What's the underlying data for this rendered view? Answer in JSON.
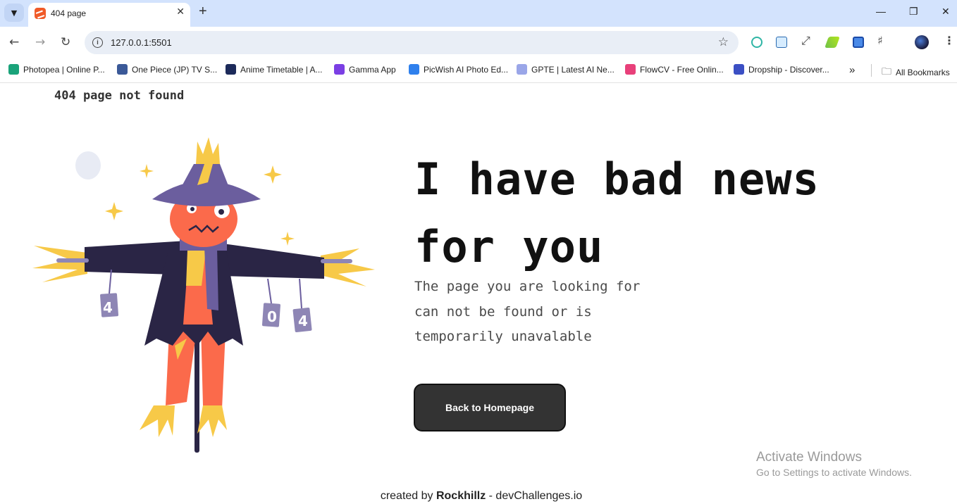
{
  "browser": {
    "tab_title": "404 page",
    "url": "127.0.0.1:5501",
    "bookmarks": [
      {
        "label": "Photopea | Online P...",
        "color": "#1aa37a"
      },
      {
        "label": "One Piece (JP) TV S...",
        "color": "#3b5998"
      },
      {
        "label": "Anime Timetable | A...",
        "color": "#1c2a5a"
      },
      {
        "label": "Gamma App",
        "color": "#7b3fe4"
      },
      {
        "label": "PicWish AI Photo Ed...",
        "color": "#2f80ed"
      },
      {
        "label": "GPTE | Latest AI Ne...",
        "color": "#9aa6e8"
      },
      {
        "label": "FlowCV - Free Onlin...",
        "color": "#e8407a"
      },
      {
        "label": "Dropship - Discover...",
        "color": "#3b4fc4"
      }
    ],
    "more_bookmarks": "»",
    "all_bookmarks": "All Bookmarks"
  },
  "page": {
    "logo": "404 page not found",
    "headline_line1": "I have bad news",
    "headline_line2": "for you",
    "sub_line1": "The page you are looking for",
    "sub_line2": "can not be found or is",
    "sub_line3": "temporarily unavalable",
    "button_label": "Back to Homepage",
    "footer_prefix": "created by ",
    "footer_author": "Rockhillz",
    "footer_suffix": " - devChallenges.io"
  },
  "illustration": {
    "sign_left": "4",
    "sign_mid": "0",
    "sign_right": "4"
  },
  "os_overlay": {
    "title": "Activate Windows",
    "subtitle": "Go to Settings to activate Windows."
  }
}
